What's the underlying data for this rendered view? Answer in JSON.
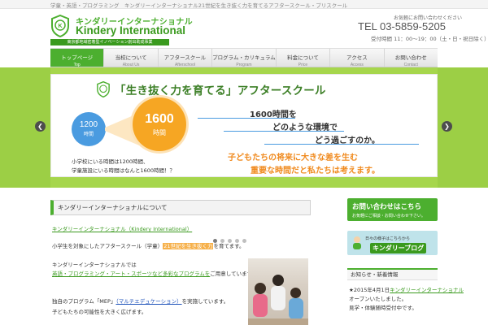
{
  "topbar": {
    "tagline": "学童・英語・プログラミング　キンダリーインターナショナル21世紀を生き抜く力を育てるアフタースクール・プリスクール"
  },
  "header": {
    "logo_jp": "キンダリーインターナショナル",
    "logo_en": "Kindery International",
    "logo_strip": "東京都地域密着型イノベーション創出助成事業",
    "contact_top": "お気軽にお問い合わせください",
    "tel": "TEL 03-5859-5205",
    "hours": "受付時間 11：00～19：00（土・日・祝日除く）"
  },
  "nav": [
    {
      "jp": "トップページ",
      "en": "Top"
    },
    {
      "jp": "当校について",
      "en": "About Us"
    },
    {
      "jp": "アフタースクール",
      "en": "Afterschool"
    },
    {
      "jp": "プログラム・カリキュラム",
      "en": "Program"
    },
    {
      "jp": "料金について",
      "en": "Price"
    },
    {
      "jp": "アクセス",
      "en": "Access"
    },
    {
      "jp": "お問い合わせ",
      "en": "Contact"
    }
  ],
  "slide": {
    "title": "「生き抜く力を育てる」アフタースクール",
    "circle_small_num": "1200",
    "circle_small_unit": "時間",
    "circle_big_num": "1600",
    "circle_big_unit": "時間",
    "note1": "小学校にいる時間は1200時間、",
    "note2": "学童施設にいる時間はなんと1600時間！？",
    "hours_line1": "1600時間を",
    "hours_line2": "どのような環境で",
    "hours_line3": "どう過ごすのか。",
    "orange1": "子どもたちの将来に大きな差を生む",
    "orange2": "重要な時間だと私たちは考えます。"
  },
  "main": {
    "title": "キンダリーインターナショナルについて",
    "p1": "キンダリーインターナショナル（Kindery International）",
    "p2_a": "小学生を対象にしたアフタースクール（学童）",
    "p2_b": "21世紀を生き抜く力",
    "p2_c": "を育てます。",
    "p3": "キンダリーインターナショナルでは",
    "p4": "英語・プログラミング・アート・スポーツなど多彩なプログラムを",
    "p4_rest": "ご用意しています。",
    "p5_a": "独自のプログラム「MEP」",
    "p5_b": "（マルチエデュケーション）",
    "p5_c": "を実施しています。",
    "p6": "子どもたちの可能性を大きく広げます。"
  },
  "sidebar": {
    "contact_t1": "お問い合わせはこちら",
    "contact_t2": "お気軽にご相談・お問い合わせ下さい。",
    "blog_t1": "日々の様子はこちらから",
    "blog_t2": "キンダリーブログ",
    "news_head": "お知らせ・新着情報",
    "news1_a": "★2015年4月1日",
    "news1_b": "キンダリーインターナショナル",
    "news2": "オープンいたしました。",
    "news3": "見学・体験随時受付中です。"
  }
}
